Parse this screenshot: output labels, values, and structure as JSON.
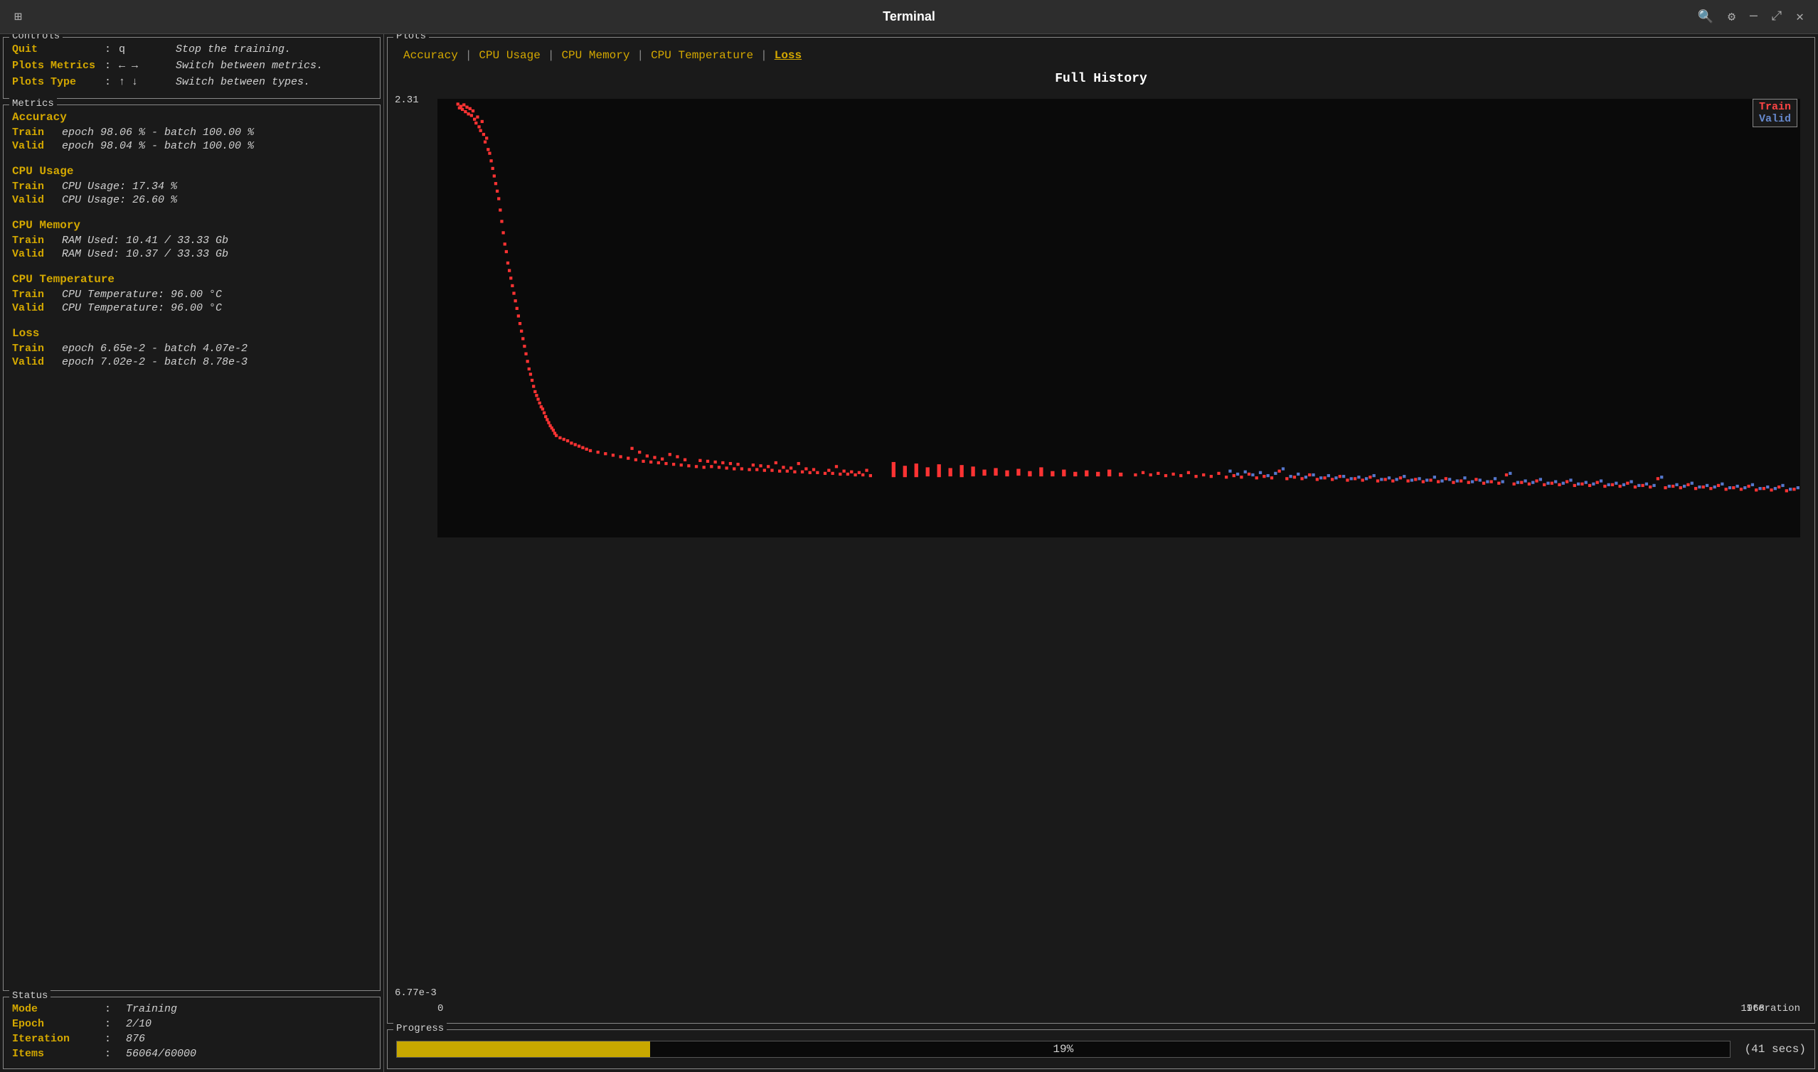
{
  "window": {
    "title": "Terminal"
  },
  "controls": {
    "section_label": "Controls",
    "rows": [
      {
        "key": "Quit",
        "colon": ":",
        "value": "q",
        "desc": "Stop the training."
      },
      {
        "key": "Plots Metrics",
        "colon": ":",
        "value": "← →",
        "desc": "Switch between metrics."
      },
      {
        "key": "Plots Type",
        "colon": ":",
        "value": "↑ ↓",
        "desc": "Switch between types."
      }
    ]
  },
  "metrics": {
    "section_label": "Metrics",
    "groups": [
      {
        "title": "Accuracy",
        "rows": [
          {
            "label": "Train",
            "value": "epoch 98.06 % - batch 100.00 %"
          },
          {
            "label": "Valid",
            "value": "epoch 98.04 % - batch 100.00 %"
          }
        ]
      },
      {
        "title": "CPU Usage",
        "rows": [
          {
            "label": "Train",
            "value": "CPU Usage: 17.34 %"
          },
          {
            "label": "Valid",
            "value": "CPU Usage: 26.60 %"
          }
        ]
      },
      {
        "title": "CPU Memory",
        "rows": [
          {
            "label": "Train",
            "value": "RAM Used: 10.41 / 33.33 Gb"
          },
          {
            "label": "Valid",
            "value": "RAM Used: 10.37 / 33.33 Gb"
          }
        ]
      },
      {
        "title": "CPU Temperature",
        "rows": [
          {
            "label": "Train",
            "value": "CPU Temperature: 96.00 °C"
          },
          {
            "label": "Valid",
            "value": "CPU Temperature: 96.00 °C"
          }
        ]
      },
      {
        "title": "Loss",
        "rows": [
          {
            "label": "Train",
            "value": "epoch 6.65e-2 - batch 4.07e-2"
          },
          {
            "label": "Valid",
            "value": "epoch 7.02e-2 - batch 8.78e-3"
          }
        ]
      }
    ]
  },
  "status": {
    "section_label": "Status",
    "rows": [
      {
        "key": "Mode",
        "colon": ":",
        "value": "Training"
      },
      {
        "key": "Epoch",
        "colon": ":",
        "value": "2/10"
      },
      {
        "key": "Iteration",
        "colon": ":",
        "value": "876"
      },
      {
        "key": "Items",
        "colon": ":",
        "value": "56064/60000"
      }
    ]
  },
  "plots": {
    "section_label": "Plots",
    "tabs": [
      {
        "label": "Accuracy",
        "active": false
      },
      {
        "label": "CPU Usage",
        "active": false
      },
      {
        "label": "CPU Memory",
        "active": false
      },
      {
        "label": "CPU Temperature",
        "active": false
      },
      {
        "label": "Loss",
        "active": true
      }
    ],
    "chart_title": "Full History",
    "y_max": "2.31",
    "y_min": "6.77e-3",
    "x_min": "0",
    "x_max": "1968",
    "x_label": "Iteration",
    "legend": {
      "train_label": "Train",
      "valid_label": "Valid"
    }
  },
  "progress": {
    "section_label": "Progress",
    "percent": 19,
    "percent_label": "19%",
    "time_label": "(41 secs)"
  }
}
